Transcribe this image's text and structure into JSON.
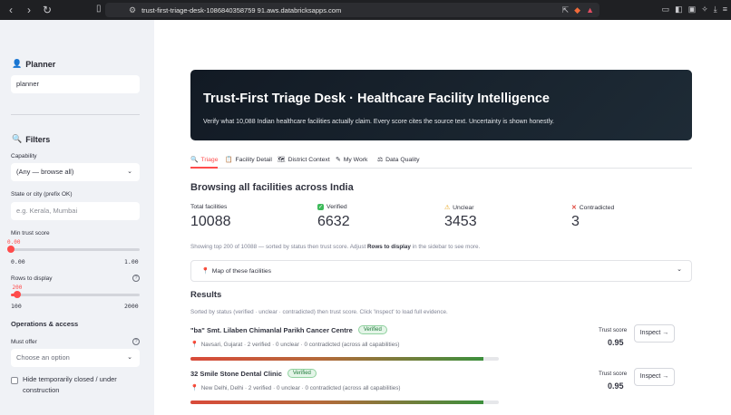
{
  "browser": {
    "url": "trust-first-triage-desk-1086840358759 91.aws.databricksapps.com"
  },
  "sidebar": {
    "planner_heading": "Planner",
    "planner_value": "planner",
    "filters_heading": "Filters",
    "capability_label": "Capability",
    "capability_value": "(Any — browse all)",
    "state_label": "State or city (prefix OK)",
    "state_placeholder": "e.g. Kerala, Mumbai",
    "min_trust_label": "Min trust score",
    "min_trust_value": "0.00",
    "min_trust_value_num": 0,
    "min_trust_min": "0.00",
    "min_trust_max": "1.00",
    "rows_label": "Rows to display",
    "rows_value": "200",
    "rows_value_num": 200,
    "rows_min": "100",
    "rows_max": "2000",
    "ops_heading": "Operations & access",
    "must_offer_label": "Must offer",
    "must_offer_placeholder": "Choose an option",
    "hide_closed_label": "Hide temporarily closed / under construction",
    "hide_closed_checked": false
  },
  "hero": {
    "title": "Trust-First Triage Desk · Healthcare Facility Intelligence",
    "subtitle": "Verify what 10,088 Indian healthcare facilities actually claim. Every score cites the source text. Uncertainty is shown honestly."
  },
  "tabs": [
    {
      "label": "Triage",
      "icon": "magnifier-icon",
      "active": true
    },
    {
      "label": "Facility Detail",
      "icon": "clipboard-icon",
      "active": false
    },
    {
      "label": "District Context",
      "icon": "map-icon",
      "active": false
    },
    {
      "label": "My Work",
      "icon": "pencil-icon",
      "active": false
    },
    {
      "label": "Data Quality",
      "icon": "scale-icon",
      "active": false
    }
  ],
  "main": {
    "heading": "Browsing all facilities across India",
    "metrics": [
      {
        "label": "Total facilities",
        "value": "10088",
        "icon": ""
      },
      {
        "label": "Verified",
        "value": "6632",
        "icon": "check-icon"
      },
      {
        "label": "Unclear",
        "value": "3453",
        "icon": "warning-icon"
      },
      {
        "label": "Contradicted",
        "value": "3",
        "icon": "cross-icon"
      }
    ],
    "caption_pre": "Showing top 200 of 10088 — sorted by status then trust score. Adjust ",
    "caption_bold": "Rows to display",
    "caption_post": " in the sidebar to see more.",
    "map_expander": "Map of these facilities",
    "results_heading": "Results",
    "results_caption": "Sorted by status (verified · unclear · contradicted) then trust score. Click 'Inspect' to load full evidence."
  },
  "results": [
    {
      "name": "\"ba\" Smt. Lilaben Chimanlal Parikh Cancer Centre",
      "status": "Verified",
      "meta": "Navsari, Gujarat · 2 verified · 0 unclear · 0 contradicted (across all capabilities)",
      "trust_label": "Trust score",
      "trust_score": "0.95",
      "trust_num": 0.95,
      "button": "Inspect →"
    },
    {
      "name": "32 Smile Stone Dental Clinic",
      "status": "Verified",
      "meta": "New Delhi, Delhi · 2 verified · 0 unclear · 0 contradicted (across all capabilities)",
      "trust_label": "Trust score",
      "trust_score": "0.95",
      "trust_num": 0.95,
      "button": "Inspect →"
    }
  ]
}
